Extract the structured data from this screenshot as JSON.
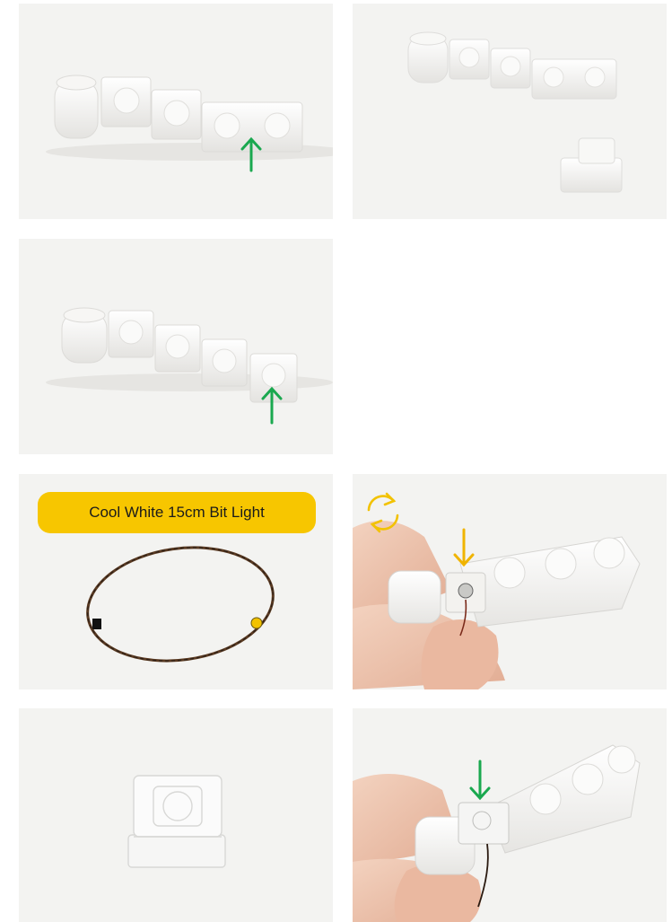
{
  "steps": [
    {
      "arrow": "up",
      "arrow_color": "#1aa84f"
    },
    {},
    {
      "arrow": "up",
      "arrow_color": "#1aa84f"
    },
    {
      "part_label": "Cool White 15cm Bit Light",
      "label_color": "#f7c600"
    },
    {
      "arrow": "down",
      "arrow_color": "#f0b400",
      "rotate_icon_color": "#f2c200"
    },
    {},
    {
      "arrow": "down",
      "arrow_color": "#1aa84f"
    }
  ]
}
